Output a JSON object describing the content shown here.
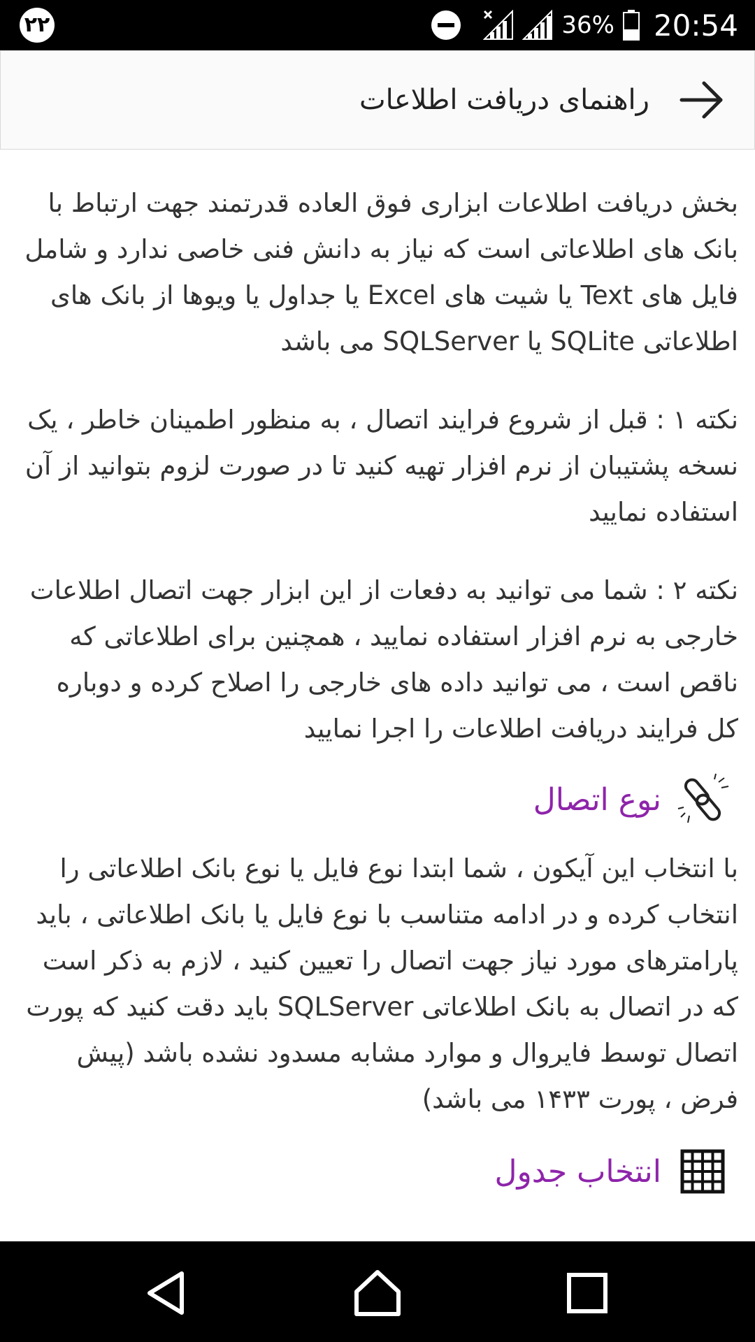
{
  "status_bar": {
    "notification_count": "۲۲",
    "battery_percent": "36%",
    "time": "20:54"
  },
  "app_bar": {
    "title": "راهنمای دریافت اطلاعات"
  },
  "content": {
    "intro": "بخش دریافت اطلاعات ابزاری فوق العاده قدرتمند جهت ارتباط با بانک های اطلاعاتی است که نیاز به دانش فنی خاصی ندارد و شامل فایل های Text یا شیت های Excel یا جداول یا ویوها از بانک های اطلاعاتی SQLite یا SQLServer می باشد",
    "note1": "نکته ۱ : قبل از شروع فرایند اتصال ، به منظور اطمینان خاطر ، یک نسخه پشتیبان از نرم افزار تهیه کنید تا در صورت لزوم بتوانید از آن استفاده نمایید",
    "note2": "نکته ۲ : شما می توانید به دفعات از این ابزار جهت اتصال اطلاعات خارجی به نرم افزار استفاده نمایید ، همچنین برای اطلاعاتی که ناقص است ، می توانید داده های خارجی را اصلاح کرده و دوباره کل فرایند دریافت اطلاعات را اجرا نمایید",
    "connection_heading": "نوع اتصال",
    "connection_text": "با انتخاب این آیکون ، شما ابتدا نوع فایل یا نوع بانک اطلاعاتی را انتخاب کرده و در ادامه متناسب با نوع فایل یا بانک اطلاعاتی ، باید پارامترهای مورد نیاز جهت اتصال را تعیین کنید ، لازم به ذکر است که در اتصال به بانک اطلاعاتی SQLServer باید دقت کنید که پورت اتصال توسط فایروال و موارد مشابه مسدود نشده باشد (پیش فرض ، پورت ۱۴۳۳ می باشد)",
    "table_heading": "انتخاب جدول"
  },
  "colors": {
    "accent": "#8e24aa",
    "text": "#333333",
    "bars": "#000000"
  },
  "icons": {
    "back": "arrow-right-icon",
    "connection": "link-icon",
    "table": "grid-icon",
    "nav_back": "triangle-back-icon",
    "nav_home": "home-icon",
    "nav_recents": "square-recents-icon"
  }
}
